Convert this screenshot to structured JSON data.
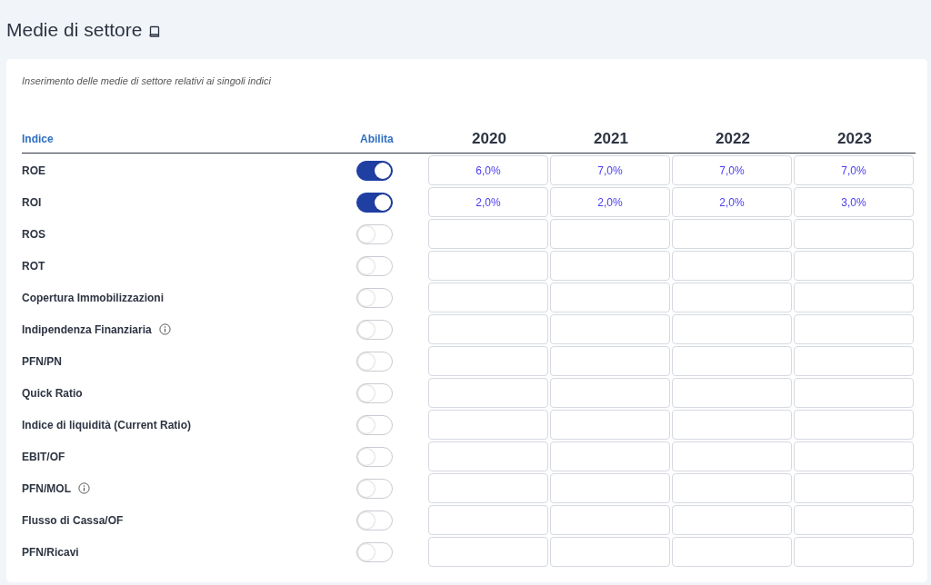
{
  "page": {
    "title": "Medie di settore"
  },
  "card": {
    "description": "Inserimento delle medie di settore relativi ai singoli indici"
  },
  "table": {
    "columns": {
      "index": "Indice",
      "enable": "Abilita",
      "years": [
        "2020",
        "2021",
        "2022",
        "2023"
      ]
    },
    "rows": [
      {
        "name": "ROE",
        "info": false,
        "enabled": true,
        "values": [
          "6,0%",
          "7,0%",
          "7,0%",
          "7,0%"
        ]
      },
      {
        "name": "ROI",
        "info": false,
        "enabled": true,
        "values": [
          "2,0%",
          "2,0%",
          "2,0%",
          "3,0%"
        ]
      },
      {
        "name": "ROS",
        "info": false,
        "enabled": false,
        "values": []
      },
      {
        "name": "ROT",
        "info": false,
        "enabled": false,
        "values": []
      },
      {
        "name": "Copertura Immobilizzazioni",
        "info": false,
        "enabled": false,
        "values": []
      },
      {
        "name": "Indipendenza Finanziaria",
        "info": true,
        "enabled": false,
        "values": []
      },
      {
        "name": "PFN/PN",
        "info": false,
        "enabled": false,
        "values": []
      },
      {
        "name": "Quick Ratio",
        "info": false,
        "enabled": false,
        "values": []
      },
      {
        "name": "Indice di liquidità (Current Ratio)",
        "info": false,
        "enabled": false,
        "values": []
      },
      {
        "name": "EBIT/OF",
        "info": false,
        "enabled": false,
        "values": []
      },
      {
        "name": "PFN/MOL",
        "info": true,
        "enabled": false,
        "values": []
      },
      {
        "name": "Flusso di Cassa/OF",
        "info": false,
        "enabled": false,
        "values": []
      },
      {
        "name": "PFN/Ricavi",
        "info": false,
        "enabled": false,
        "values": []
      }
    ]
  }
}
